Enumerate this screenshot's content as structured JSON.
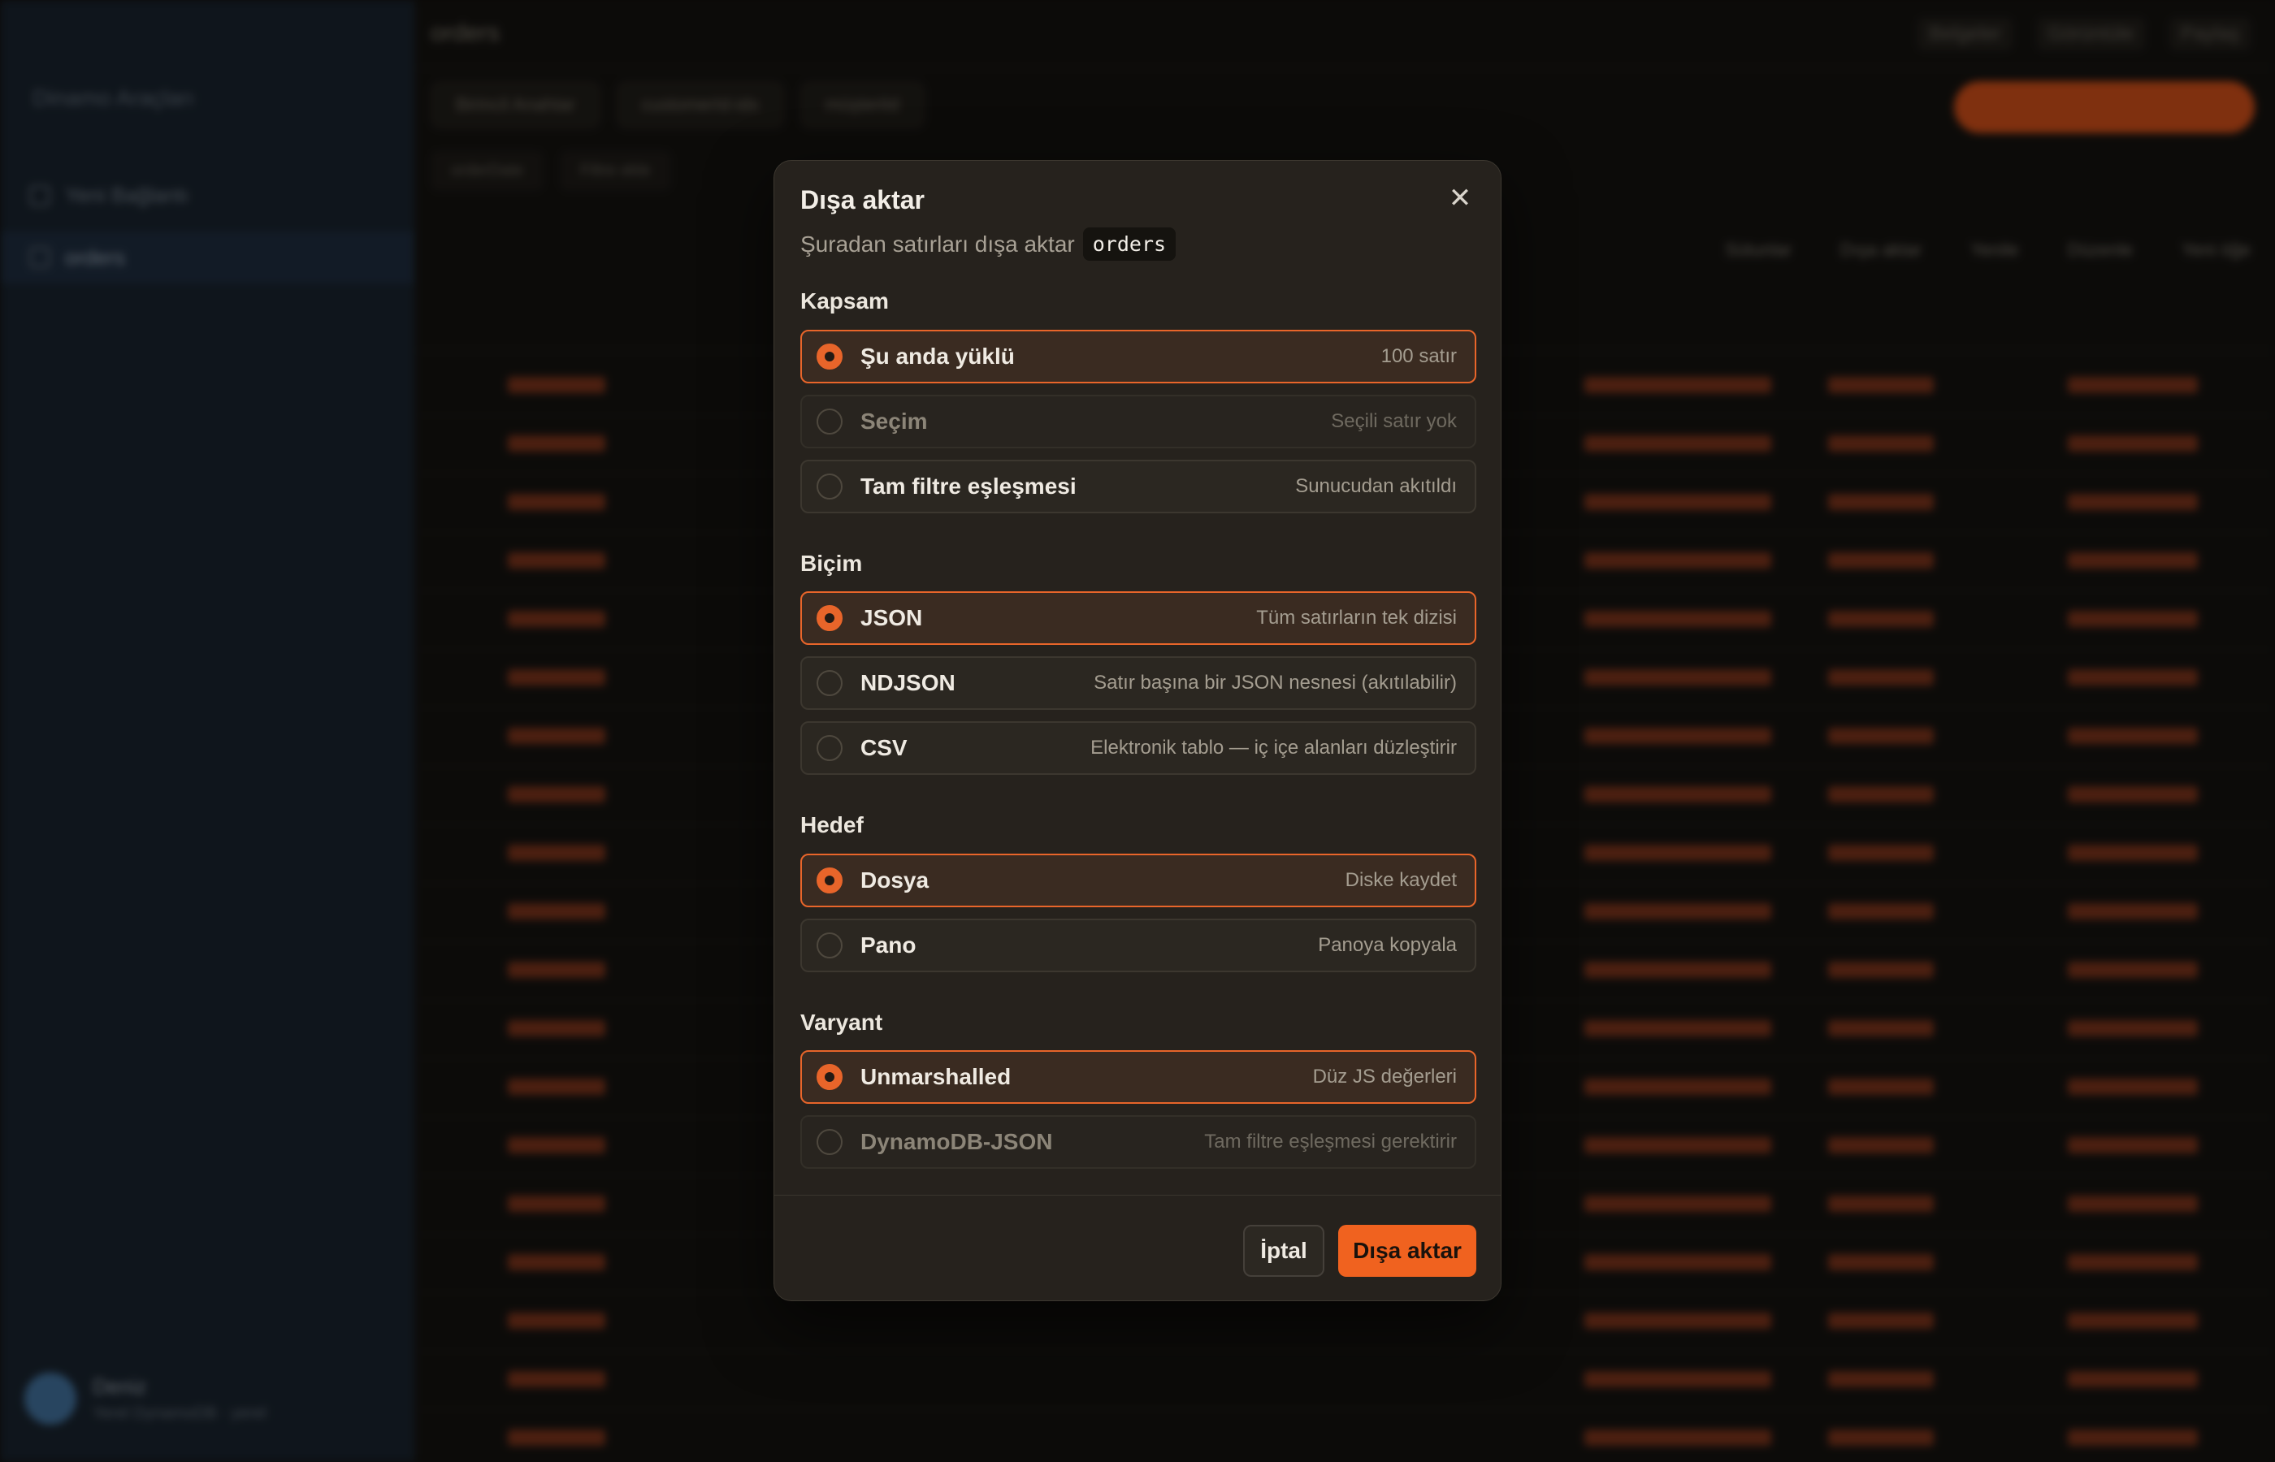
{
  "background": {
    "sidebar": {
      "brand": "Dinamo Araçları",
      "items": [
        {
          "label": "Yeni Bağlantı"
        },
        {
          "label": "orders"
        }
      ],
      "user": {
        "name": "Deniz",
        "sub": "Yerel DynamoDB · yerel"
      }
    },
    "topbar": {
      "title": "orders",
      "right": [
        "Belgeler",
        "Görüntüle",
        "Paylaş"
      ]
    },
    "toolbar": {
      "pills": [
        "Birincil Anahtar",
        "customerId-idx",
        "müşteriId"
      ]
    },
    "filters": [
      "orderDate",
      "Filtre ekle"
    ],
    "actions": [
      "Sütunlar",
      "Dışa aktar",
      "Yenile",
      "Düzenle",
      "Yeni öğe"
    ],
    "rows_count": 19
  },
  "dialog": {
    "title": "Dışa aktar",
    "subtitle": "Şuradan satırları dışa aktar",
    "table_name": "orders",
    "close_icon": "close-icon",
    "sections": [
      {
        "title": "Kapsam",
        "options": [
          {
            "label": "Şu anda yüklü",
            "hint": "100 satır",
            "state": "selected"
          },
          {
            "label": "Seçim",
            "hint": "Seçili satır yok",
            "state": "disabled"
          },
          {
            "label": "Tam filtre eşleşmesi",
            "hint": "Sunucudan akıtıldı",
            "state": "normal"
          }
        ]
      },
      {
        "title": "Biçim",
        "options": [
          {
            "label": "JSON",
            "hint": "Tüm satırların tek dizisi",
            "state": "selected"
          },
          {
            "label": "NDJSON",
            "hint": "Satır başına bir JSON nesnesi (akıtılabilir)",
            "state": "normal"
          },
          {
            "label": "CSV",
            "hint": "Elektronik tablo — iç içe alanları düzleştirir",
            "state": "normal"
          }
        ]
      },
      {
        "title": "Hedef",
        "options": [
          {
            "label": "Dosya",
            "hint": "Diske kaydet",
            "state": "selected"
          },
          {
            "label": "Pano",
            "hint": "Panoya kopyala",
            "state": "normal"
          }
        ]
      },
      {
        "title": "Varyant",
        "options": [
          {
            "label": "Unmarshalled",
            "hint": "Düz JS değerleri",
            "state": "selected"
          },
          {
            "label": "DynamoDB-JSON",
            "hint": "Tam filtre eşleşmesi gerektirir",
            "state": "disabled"
          }
        ]
      }
    ],
    "cancel_label": "İptal",
    "export_label": "Dışa aktar"
  },
  "colors": {
    "accent": "#f0621f",
    "dialog_bg": "#26221d",
    "sidebar_bg": "#1c2733"
  }
}
